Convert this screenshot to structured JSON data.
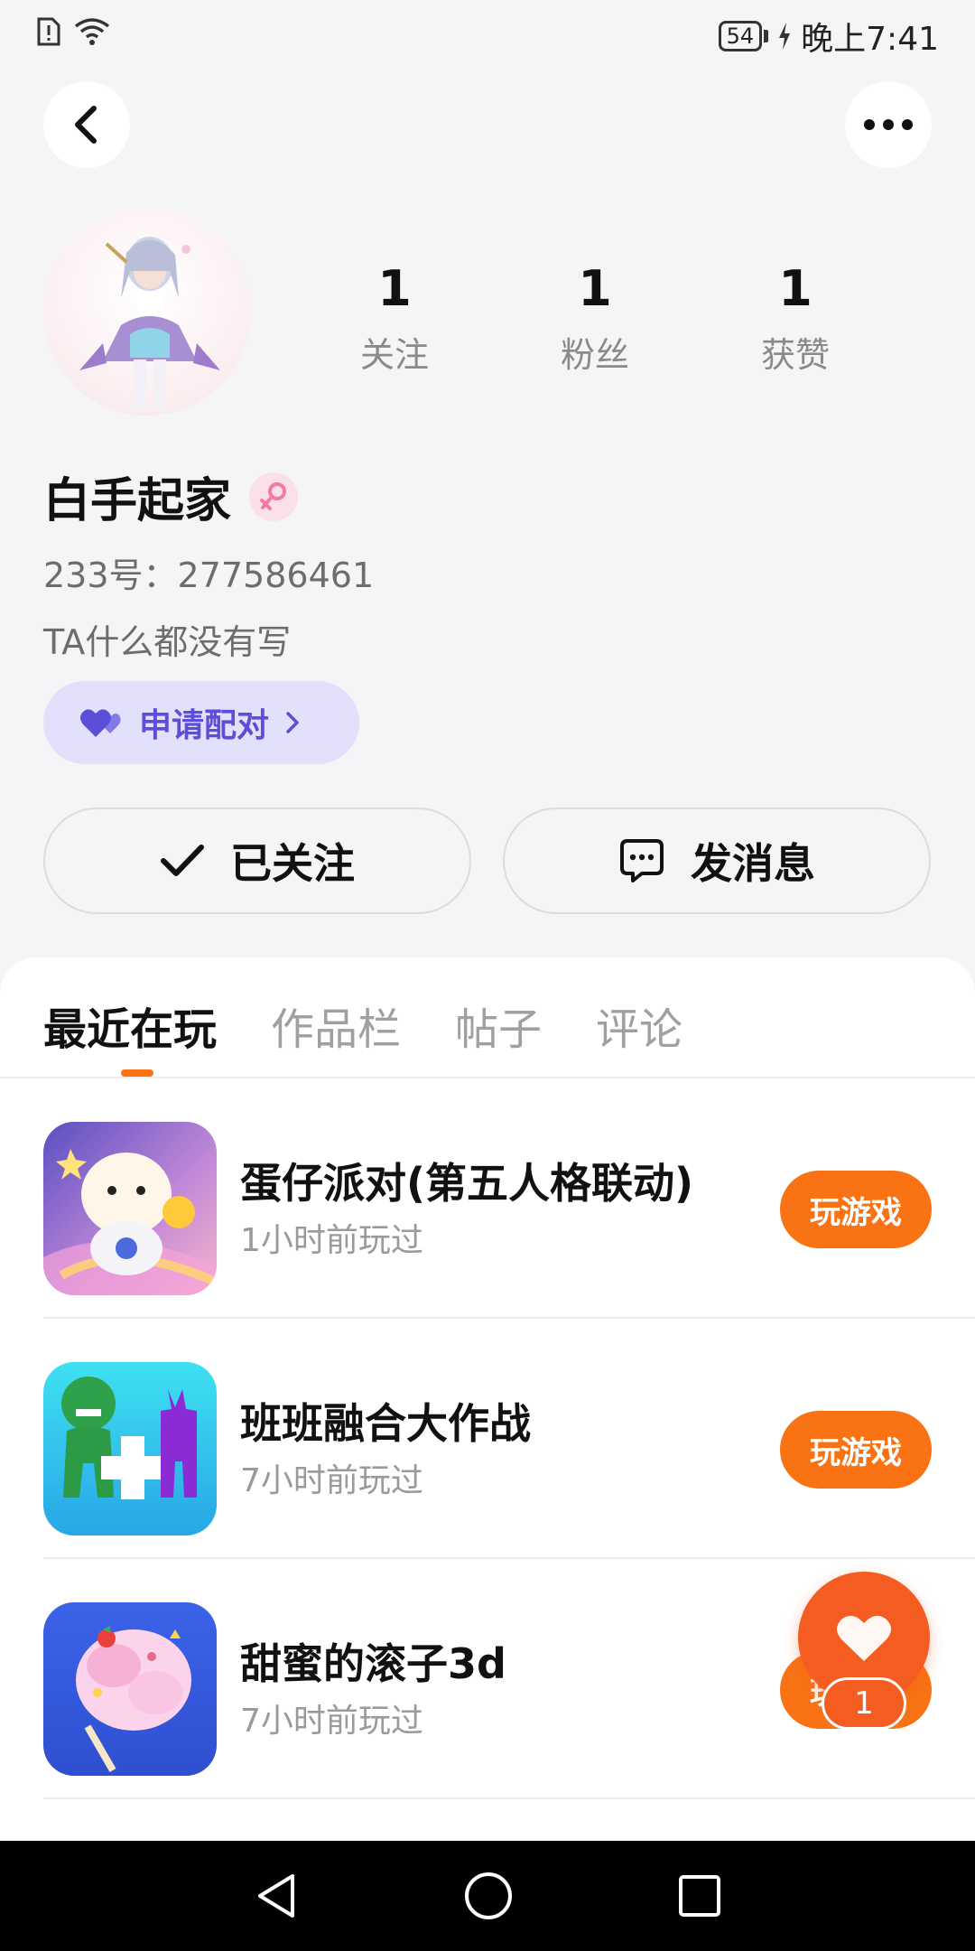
{
  "status_bar": {
    "battery": "54",
    "time": "晚上7:41"
  },
  "profile": {
    "stats": [
      {
        "value": "1",
        "label": "关注"
      },
      {
        "value": "1",
        "label": "粉丝"
      },
      {
        "value": "1",
        "label": "获赞"
      }
    ],
    "nickname": "白手起家",
    "uid": "233号：277586461",
    "bio": "TA什么都没有写",
    "pair_button": "申请配对",
    "follow_button": "已关注",
    "message_button": "发消息"
  },
  "tabs": [
    "最近在玩",
    "作品栏",
    "帖子",
    "评论"
  ],
  "games": [
    {
      "title": "蛋仔派对(第五人格联动)",
      "played": "1小时前玩过",
      "button": "玩游戏"
    },
    {
      "title": "班班融合大作战",
      "played": "7小时前玩过",
      "button": "玩游戏"
    },
    {
      "title": "甜蜜的滚子3d",
      "played": "7小时前玩过",
      "button": "玩游戏"
    }
  ],
  "like_fab": {
    "count": "1"
  },
  "colors": {
    "accent": "#f97315",
    "pair_purple": "#5b4ed8",
    "fab": "#f45c22"
  }
}
